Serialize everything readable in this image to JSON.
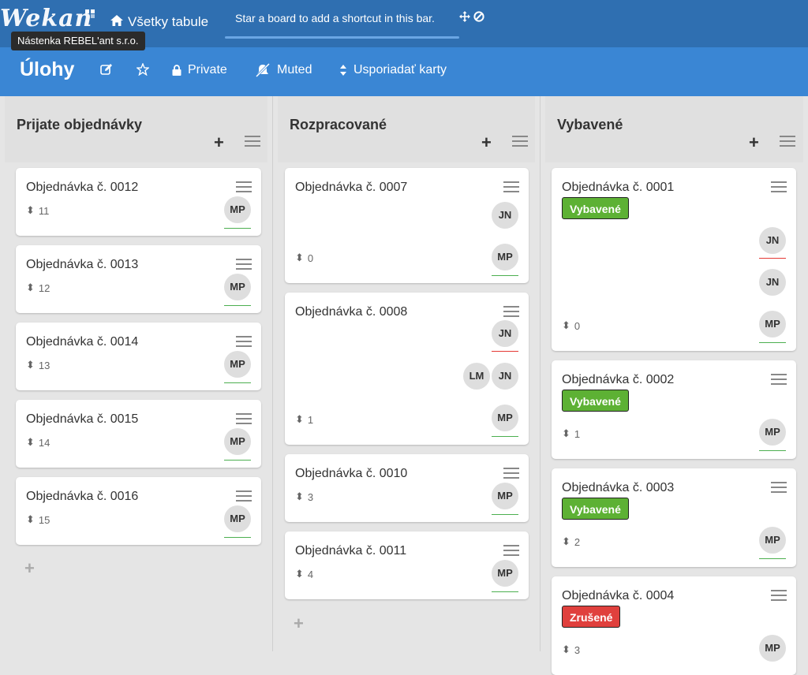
{
  "header": {
    "logo": "Wekan",
    "all_boards": "Všetky tabule",
    "star_hint": "Star a board to add a shortcut in this bar.",
    "tooltip": "Nástenka REBEL'ant s.r.o."
  },
  "board": {
    "title": "Úlohy",
    "private_label": "Private",
    "muted_label": "Muted",
    "sort_label": "Usporiadať karty"
  },
  "lists": [
    {
      "title": "Prijate objednávky",
      "cards": [
        {
          "title": "Objednávka č. 0012",
          "sort": "11",
          "avatar": "MP"
        },
        {
          "title": "Objednávka č. 0013",
          "sort": "12",
          "avatar": "MP"
        },
        {
          "title": "Objednávka č. 0014",
          "sort": "13",
          "avatar": "MP"
        },
        {
          "title": "Objednávka č. 0015",
          "sort": "14",
          "avatar": "MP"
        },
        {
          "title": "Objednávka č. 0016",
          "sort": "15",
          "avatar": "MP"
        }
      ]
    },
    {
      "title": "Rozpracované",
      "cards": [
        {
          "title": "Objednávka č. 0007",
          "sort": "0",
          "avatars": [
            "JN",
            "MP"
          ]
        },
        {
          "title": "Objednávka č. 0008",
          "sort": "1",
          "avatars": [
            "JN",
            "LM",
            "JN",
            "MP"
          ]
        },
        {
          "title": "Objednávka č. 0010",
          "sort": "3",
          "avatar": "MP"
        },
        {
          "title": "Objednávka č. 0011",
          "sort": "4",
          "avatar": "MP"
        }
      ]
    },
    {
      "title": "Vybavené",
      "cards": [
        {
          "title": "Objednávka č. 0001",
          "label": "Vybavené",
          "sort": "0",
          "avatars": [
            "JN",
            "JN",
            "MP"
          ]
        },
        {
          "title": "Objednávka č. 0002",
          "label": "Vybavené",
          "sort": "1",
          "avatar": "MP"
        },
        {
          "title": "Objednávka č. 0003",
          "label": "Vybavené",
          "sort": "2",
          "avatar": "MP"
        },
        {
          "title": "Objednávka č. 0004",
          "label": "Zrušené",
          "sort": "3",
          "avatar": "MP"
        }
      ]
    }
  ],
  "colors": {
    "topbar": "#2f6fb1",
    "boardbar": "#3a86d4",
    "label_done": "#5db134",
    "label_cancelled": "#e0403d"
  }
}
